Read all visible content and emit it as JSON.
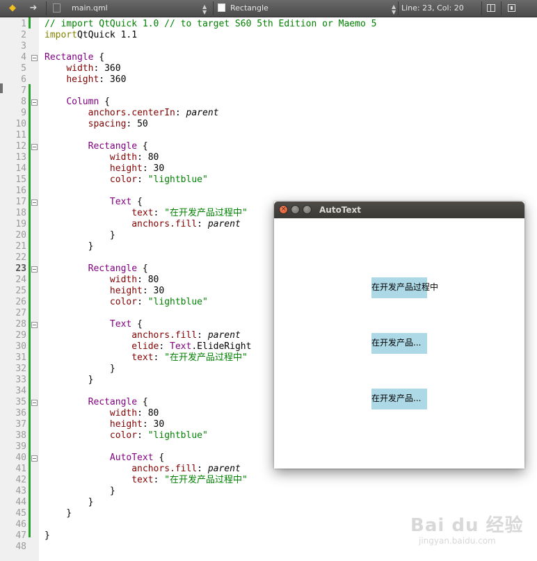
{
  "toolbar": {
    "back_icon": "back-arrow-icon",
    "forward_icon": "forward-arrow-icon",
    "file_name": "main.qml",
    "symbol": "Rectangle",
    "position": "Line: 23, Col: 20"
  },
  "colors": {
    "string": "#008000",
    "comment": "#008000",
    "keyword": "#808000",
    "type": "#800080",
    "property": "#800000",
    "change_bar": "#2aa02a",
    "qml_rect": "#add8e6"
  },
  "editor": {
    "current_line": 23,
    "lines": [
      {
        "n": "1",
        "tokens": [
          [
            "cmt",
            "// import QtQuick 1.0 // to target S60 5th Edition or Maemo 5"
          ]
        ]
      },
      {
        "n": "2",
        "tokens": [
          [
            "kw",
            "import"
          ],
          [
            "",
            "QtQuick 1.1"
          ]
        ]
      },
      {
        "n": "3",
        "tokens": []
      },
      {
        "n": "4",
        "fold": true,
        "tokens": [
          [
            "type",
            "Rectangle"
          ],
          [
            "",
            " {"
          ]
        ]
      },
      {
        "n": "5",
        "tokens": [
          [
            "",
            "    "
          ],
          [
            "prop",
            "width"
          ],
          [
            "",
            ": 360"
          ]
        ]
      },
      {
        "n": "6",
        "tokens": [
          [
            "",
            "    "
          ],
          [
            "prop",
            "height"
          ],
          [
            "",
            ": 360"
          ]
        ]
      },
      {
        "n": "7",
        "tokens": []
      },
      {
        "n": "8",
        "fold": true,
        "tokens": [
          [
            "",
            "    "
          ],
          [
            "type",
            "Column"
          ],
          [
            "",
            " {"
          ]
        ]
      },
      {
        "n": "9",
        "tokens": [
          [
            "",
            "        "
          ],
          [
            "prop",
            "anchors.centerIn"
          ],
          [
            "",
            ": "
          ],
          [
            "ident",
            "parent"
          ]
        ]
      },
      {
        "n": "10",
        "tokens": [
          [
            "",
            "        "
          ],
          [
            "prop",
            "spacing"
          ],
          [
            "",
            ": 50"
          ]
        ]
      },
      {
        "n": "11",
        "tokens": []
      },
      {
        "n": "12",
        "fold": true,
        "tokens": [
          [
            "",
            "        "
          ],
          [
            "type",
            "Rectangle"
          ],
          [
            "",
            " {"
          ]
        ]
      },
      {
        "n": "13",
        "tokens": [
          [
            "",
            "            "
          ],
          [
            "prop",
            "width"
          ],
          [
            "",
            ": 80"
          ]
        ]
      },
      {
        "n": "14",
        "tokens": [
          [
            "",
            "            "
          ],
          [
            "prop",
            "height"
          ],
          [
            "",
            ": 30"
          ]
        ]
      },
      {
        "n": "15",
        "tokens": [
          [
            "",
            "            "
          ],
          [
            "prop",
            "color"
          ],
          [
            "",
            ": "
          ],
          [
            "str",
            "\"lightblue\""
          ]
        ]
      },
      {
        "n": "16",
        "tokens": []
      },
      {
        "n": "17",
        "fold": true,
        "tokens": [
          [
            "",
            "            "
          ],
          [
            "type",
            "Text"
          ],
          [
            "",
            " {"
          ]
        ]
      },
      {
        "n": "18",
        "tokens": [
          [
            "",
            "                "
          ],
          [
            "prop",
            "text"
          ],
          [
            "",
            ": "
          ],
          [
            "str",
            "\"在开发产品过程中\""
          ]
        ]
      },
      {
        "n": "19",
        "tokens": [
          [
            "",
            "                "
          ],
          [
            "prop",
            "anchors.fill"
          ],
          [
            "",
            ": "
          ],
          [
            "ident",
            "parent"
          ]
        ]
      },
      {
        "n": "20",
        "tokens": [
          [
            "",
            "            }"
          ]
        ]
      },
      {
        "n": "21",
        "tokens": [
          [
            "",
            "        }"
          ]
        ]
      },
      {
        "n": "22",
        "tokens": []
      },
      {
        "n": "23",
        "fold": true,
        "tokens": [
          [
            "",
            "        "
          ],
          [
            "type",
            "Rectangle"
          ],
          [
            "",
            " {"
          ]
        ]
      },
      {
        "n": "24",
        "tokens": [
          [
            "",
            "            "
          ],
          [
            "prop",
            "width"
          ],
          [
            "",
            ": 80"
          ]
        ]
      },
      {
        "n": "25",
        "tokens": [
          [
            "",
            "            "
          ],
          [
            "prop",
            "height"
          ],
          [
            "",
            ": 30"
          ]
        ]
      },
      {
        "n": "26",
        "tokens": [
          [
            "",
            "            "
          ],
          [
            "prop",
            "color"
          ],
          [
            "",
            ": "
          ],
          [
            "str",
            "\"lightblue\""
          ]
        ]
      },
      {
        "n": "27",
        "tokens": []
      },
      {
        "n": "28",
        "fold": true,
        "tokens": [
          [
            "",
            "            "
          ],
          [
            "type",
            "Text"
          ],
          [
            "",
            " {"
          ]
        ]
      },
      {
        "n": "29",
        "tokens": [
          [
            "",
            "                "
          ],
          [
            "prop",
            "anchors.fill"
          ],
          [
            "",
            ": "
          ],
          [
            "ident",
            "parent"
          ]
        ]
      },
      {
        "n": "30",
        "tokens": [
          [
            "",
            "                "
          ],
          [
            "prop",
            "elide"
          ],
          [
            "",
            ": "
          ],
          [
            "type",
            "Text"
          ],
          [
            "",
            ".ElideRight"
          ]
        ]
      },
      {
        "n": "31",
        "tokens": [
          [
            "",
            "                "
          ],
          [
            "prop",
            "text"
          ],
          [
            "",
            ": "
          ],
          [
            "str",
            "\"在开发产品过程中\""
          ]
        ]
      },
      {
        "n": "32",
        "tokens": [
          [
            "",
            "            }"
          ]
        ]
      },
      {
        "n": "33",
        "tokens": [
          [
            "",
            "        }"
          ]
        ]
      },
      {
        "n": "34",
        "tokens": []
      },
      {
        "n": "35",
        "fold": true,
        "tokens": [
          [
            "",
            "        "
          ],
          [
            "type",
            "Rectangle"
          ],
          [
            "",
            " {"
          ]
        ]
      },
      {
        "n": "36",
        "tokens": [
          [
            "",
            "            "
          ],
          [
            "prop",
            "width"
          ],
          [
            "",
            ": 80"
          ]
        ]
      },
      {
        "n": "37",
        "tokens": [
          [
            "",
            "            "
          ],
          [
            "prop",
            "height"
          ],
          [
            "",
            ": 30"
          ]
        ]
      },
      {
        "n": "38",
        "tokens": [
          [
            "",
            "            "
          ],
          [
            "prop",
            "color"
          ],
          [
            "",
            ": "
          ],
          [
            "str",
            "\"lightblue\""
          ]
        ]
      },
      {
        "n": "39",
        "tokens": []
      },
      {
        "n": "40",
        "fold": true,
        "tokens": [
          [
            "",
            "            "
          ],
          [
            "type",
            "AutoText"
          ],
          [
            "",
            " {"
          ]
        ]
      },
      {
        "n": "41",
        "tokens": [
          [
            "",
            "                "
          ],
          [
            "prop",
            "anchors.fill"
          ],
          [
            "",
            ": "
          ],
          [
            "ident",
            "parent"
          ]
        ]
      },
      {
        "n": "42",
        "tokens": [
          [
            "",
            "                "
          ],
          [
            "prop",
            "text"
          ],
          [
            "",
            ": "
          ],
          [
            "str",
            "\"在开发产品过程中\""
          ]
        ]
      },
      {
        "n": "43",
        "tokens": [
          [
            "",
            "            }"
          ]
        ]
      },
      {
        "n": "44",
        "tokens": [
          [
            "",
            "        }"
          ]
        ]
      },
      {
        "n": "45",
        "tokens": [
          [
            "",
            "    }"
          ]
        ]
      },
      {
        "n": "46",
        "tokens": []
      },
      {
        "n": "47",
        "tokens": [
          [
            "",
            "}"
          ]
        ]
      },
      {
        "n": "48",
        "tokens": []
      }
    ]
  },
  "app_window": {
    "title": "AutoText",
    "close_glyph": "×",
    "close_icon": "close-icon",
    "minimize_icon": "minimize-icon",
    "maximize_icon": "maximize-icon",
    "items": [
      {
        "text": "在开发产品过程中"
      },
      {
        "text": "在开发产品..."
      },
      {
        "text": "在开发产品..."
      }
    ]
  },
  "watermark": {
    "logo": "Bai du 经验",
    "url": "jingyan.baidu.com"
  }
}
